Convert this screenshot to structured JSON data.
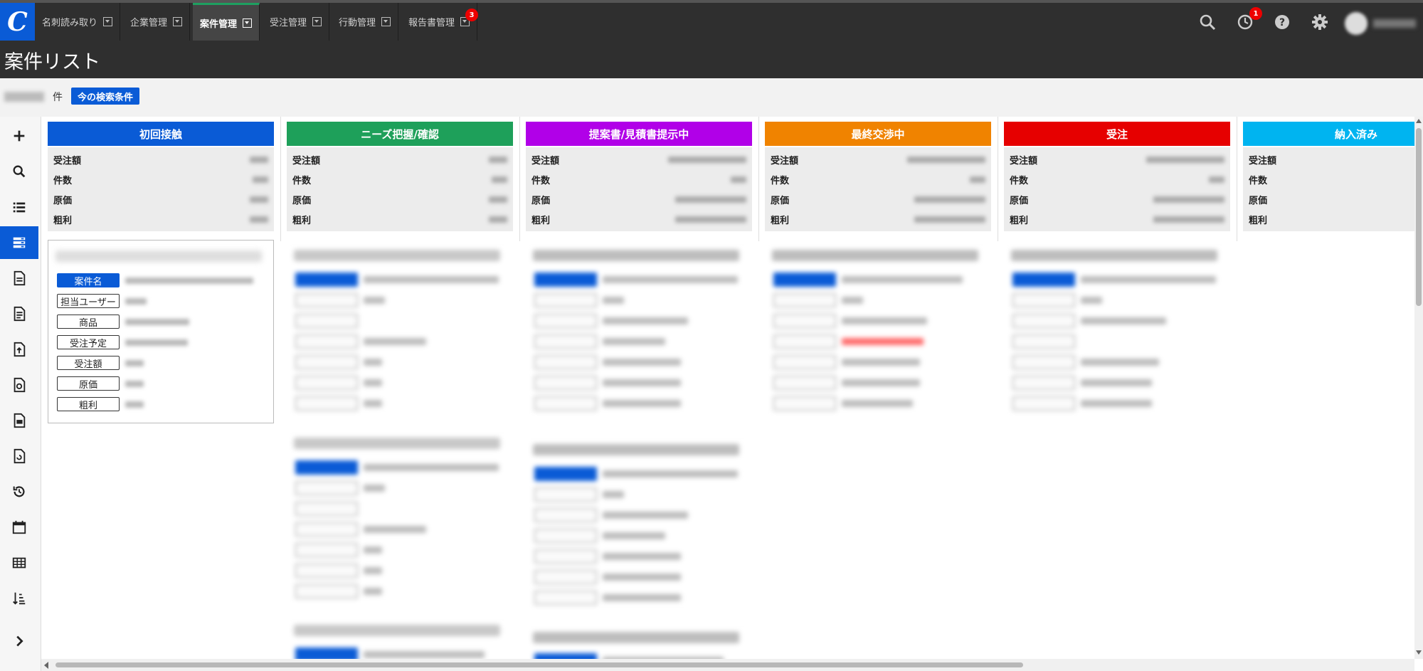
{
  "app": {
    "logo_letter": "C"
  },
  "nav": {
    "tabs": [
      {
        "label": "名刺読み取り"
      },
      {
        "label": "企業管理"
      },
      {
        "label": "案件管理",
        "active": true
      },
      {
        "label": "受注管理"
      },
      {
        "label": "行動管理"
      },
      {
        "label": "報告書管理",
        "badge": "3"
      }
    ],
    "icons": [
      "search-icon",
      "history-icon",
      "help-icon",
      "gear-icon"
    ],
    "history_badge": "1"
  },
  "page": {
    "title": "案件リスト",
    "count_unit": "件",
    "search_condition_button": "今の検索条件"
  },
  "sidebar": {
    "items": [
      "add-icon",
      "search-icon",
      "list-icon",
      "kanban-icon",
      "document-icon",
      "document-lines-icon",
      "document-upload-icon",
      "document-refresh-icon",
      "report-icon",
      "document-cycle-icon",
      "history-icon",
      "calendar-icon",
      "table-icon",
      "sort-icon",
      "expand-icon"
    ],
    "active_index": 3
  },
  "stat_labels": [
    "受注額",
    "件数",
    "原価",
    "粗利"
  ],
  "columns": [
    {
      "name": "初回接触",
      "color": "#0a5bd6"
    },
    {
      "name": "ニーズ把握/確認",
      "color": "#1ea05a"
    },
    {
      "name": "提案書/見積書提示中",
      "color": "#b100e8"
    },
    {
      "name": "最終交渉中",
      "color": "#f08300"
    },
    {
      "name": "受注",
      "color": "#e60000"
    },
    {
      "name": "納入済み",
      "color": "#00b4f0"
    }
  ],
  "card_field_labels": [
    "案件名",
    "担当ユーザー",
    "商品",
    "受注予定",
    "受注額",
    "原価",
    "粗利"
  ]
}
